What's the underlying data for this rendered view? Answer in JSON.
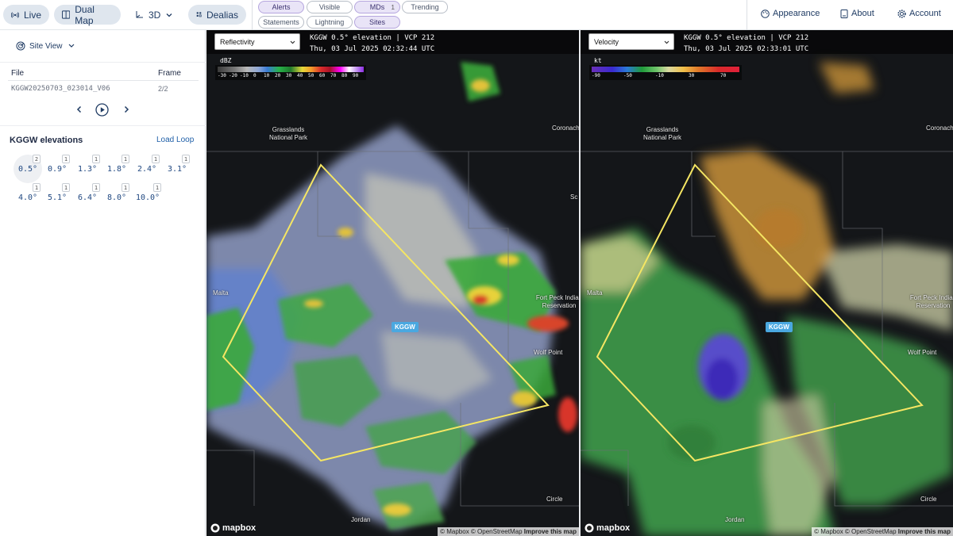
{
  "toolbar": {
    "live": "Live",
    "dual_map": "Dual Map",
    "three_d": "3D",
    "dealias": "Dealias"
  },
  "chips": {
    "alerts": "Alerts",
    "visible": "Visible",
    "mds": "MDs",
    "mds_count": "1",
    "trending": "Trending",
    "statements": "Statements",
    "lightning": "Lightning",
    "sites": "Sites"
  },
  "nav": {
    "appearance": "Appearance",
    "about": "About",
    "account": "Account"
  },
  "sidebar": {
    "site_view": "Site View",
    "file_header": "File",
    "frame_header": "Frame",
    "file_value": "KGGW20250703_023014_V06",
    "frame_value": "2/2",
    "elevations_title": "KGGW elevations",
    "load_loop": "Load Loop",
    "elevations": [
      {
        "label": "0.5°",
        "count": "2"
      },
      {
        "label": "0.9°",
        "count": "1"
      },
      {
        "label": "1.3°",
        "count": "1"
      },
      {
        "label": "1.8°",
        "count": "1"
      },
      {
        "label": "2.4°",
        "count": "1"
      },
      {
        "label": "3.1°",
        "count": "1"
      },
      {
        "label": "4.0°",
        "count": "1"
      },
      {
        "label": "5.1°",
        "count": "1"
      },
      {
        "label": "6.4°",
        "count": "1"
      },
      {
        "label": "8.0°",
        "count": "1"
      },
      {
        "label": "10.0°",
        "count": "1"
      }
    ],
    "selected_elevation": "0.5°"
  },
  "left_map": {
    "product": "Reflectivity",
    "line1": "KGGW 0.5° elevation | VCP 212",
    "line2": "Thu, 03 Jul 2025 02:32:44 UTC",
    "legend_unit": "dBZ",
    "legend_ticks": [
      "-30",
      "-20",
      "-10",
      "0",
      "10",
      "20",
      "30",
      "40",
      "50",
      "60",
      "70",
      "80",
      "90"
    ]
  },
  "right_map": {
    "product": "Velocity",
    "line1": "KGGW 0.5° elevation | VCP 212",
    "line2": "Thu, 03 Jul 2025 02:33:01 UTC",
    "legend_unit": "kt",
    "legend_ticks": [
      "-90",
      "-50",
      "-10",
      "30",
      "70"
    ]
  },
  "places": {
    "grasslands": "Grasslands National Park",
    "coronach": "Coronach",
    "malta": "Malta",
    "fort_peck": "Fort Peck Indian Reservation",
    "wolf_point": "Wolf Point",
    "circle": "Circle",
    "jordan": "Jordan",
    "sc": "Sc"
  },
  "site_id": "KGGW",
  "attribution": {
    "mapbox_logo": "mapbox",
    "mapbox": "© Mapbox",
    "osm": "© OpenStreetMap",
    "improve": "Improve this map"
  },
  "colors": {
    "accent": "#1f5fa8",
    "warning_polygon": "#f5e663",
    "site_badge": "#4aa8e0"
  }
}
